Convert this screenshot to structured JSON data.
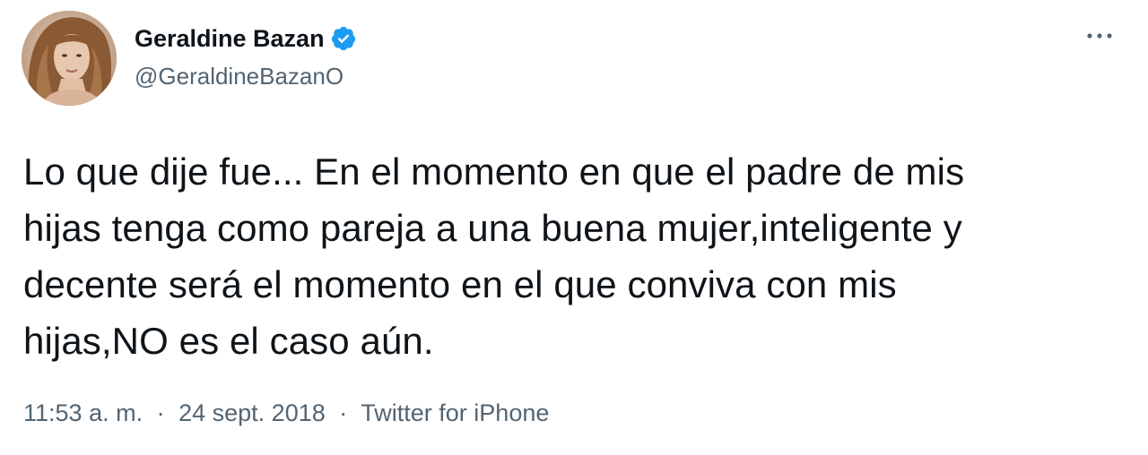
{
  "author": {
    "display_name": "Geraldine Bazan",
    "handle": "@GeraldineBazanO",
    "verified": true,
    "avatar_icon": "profile-photo"
  },
  "more_icon": "more-horizontal-icon",
  "tweet": {
    "lines": [
      "Lo que dije fue... En el momento en que el padre de mis",
      "hijas tenga como pareja a una buena mujer,inteligente y",
      "decente será el momento en el que conviva con mis",
      "hijas,NO es el caso aún."
    ]
  },
  "meta": {
    "time": "11:53 a. m.",
    "separator": "·",
    "date": "24 sept. 2018",
    "source": "Twitter for iPhone"
  },
  "colors": {
    "verified_badge": "#1d9bf0",
    "secondary_text": "#536471",
    "primary_text": "#0f1419"
  }
}
